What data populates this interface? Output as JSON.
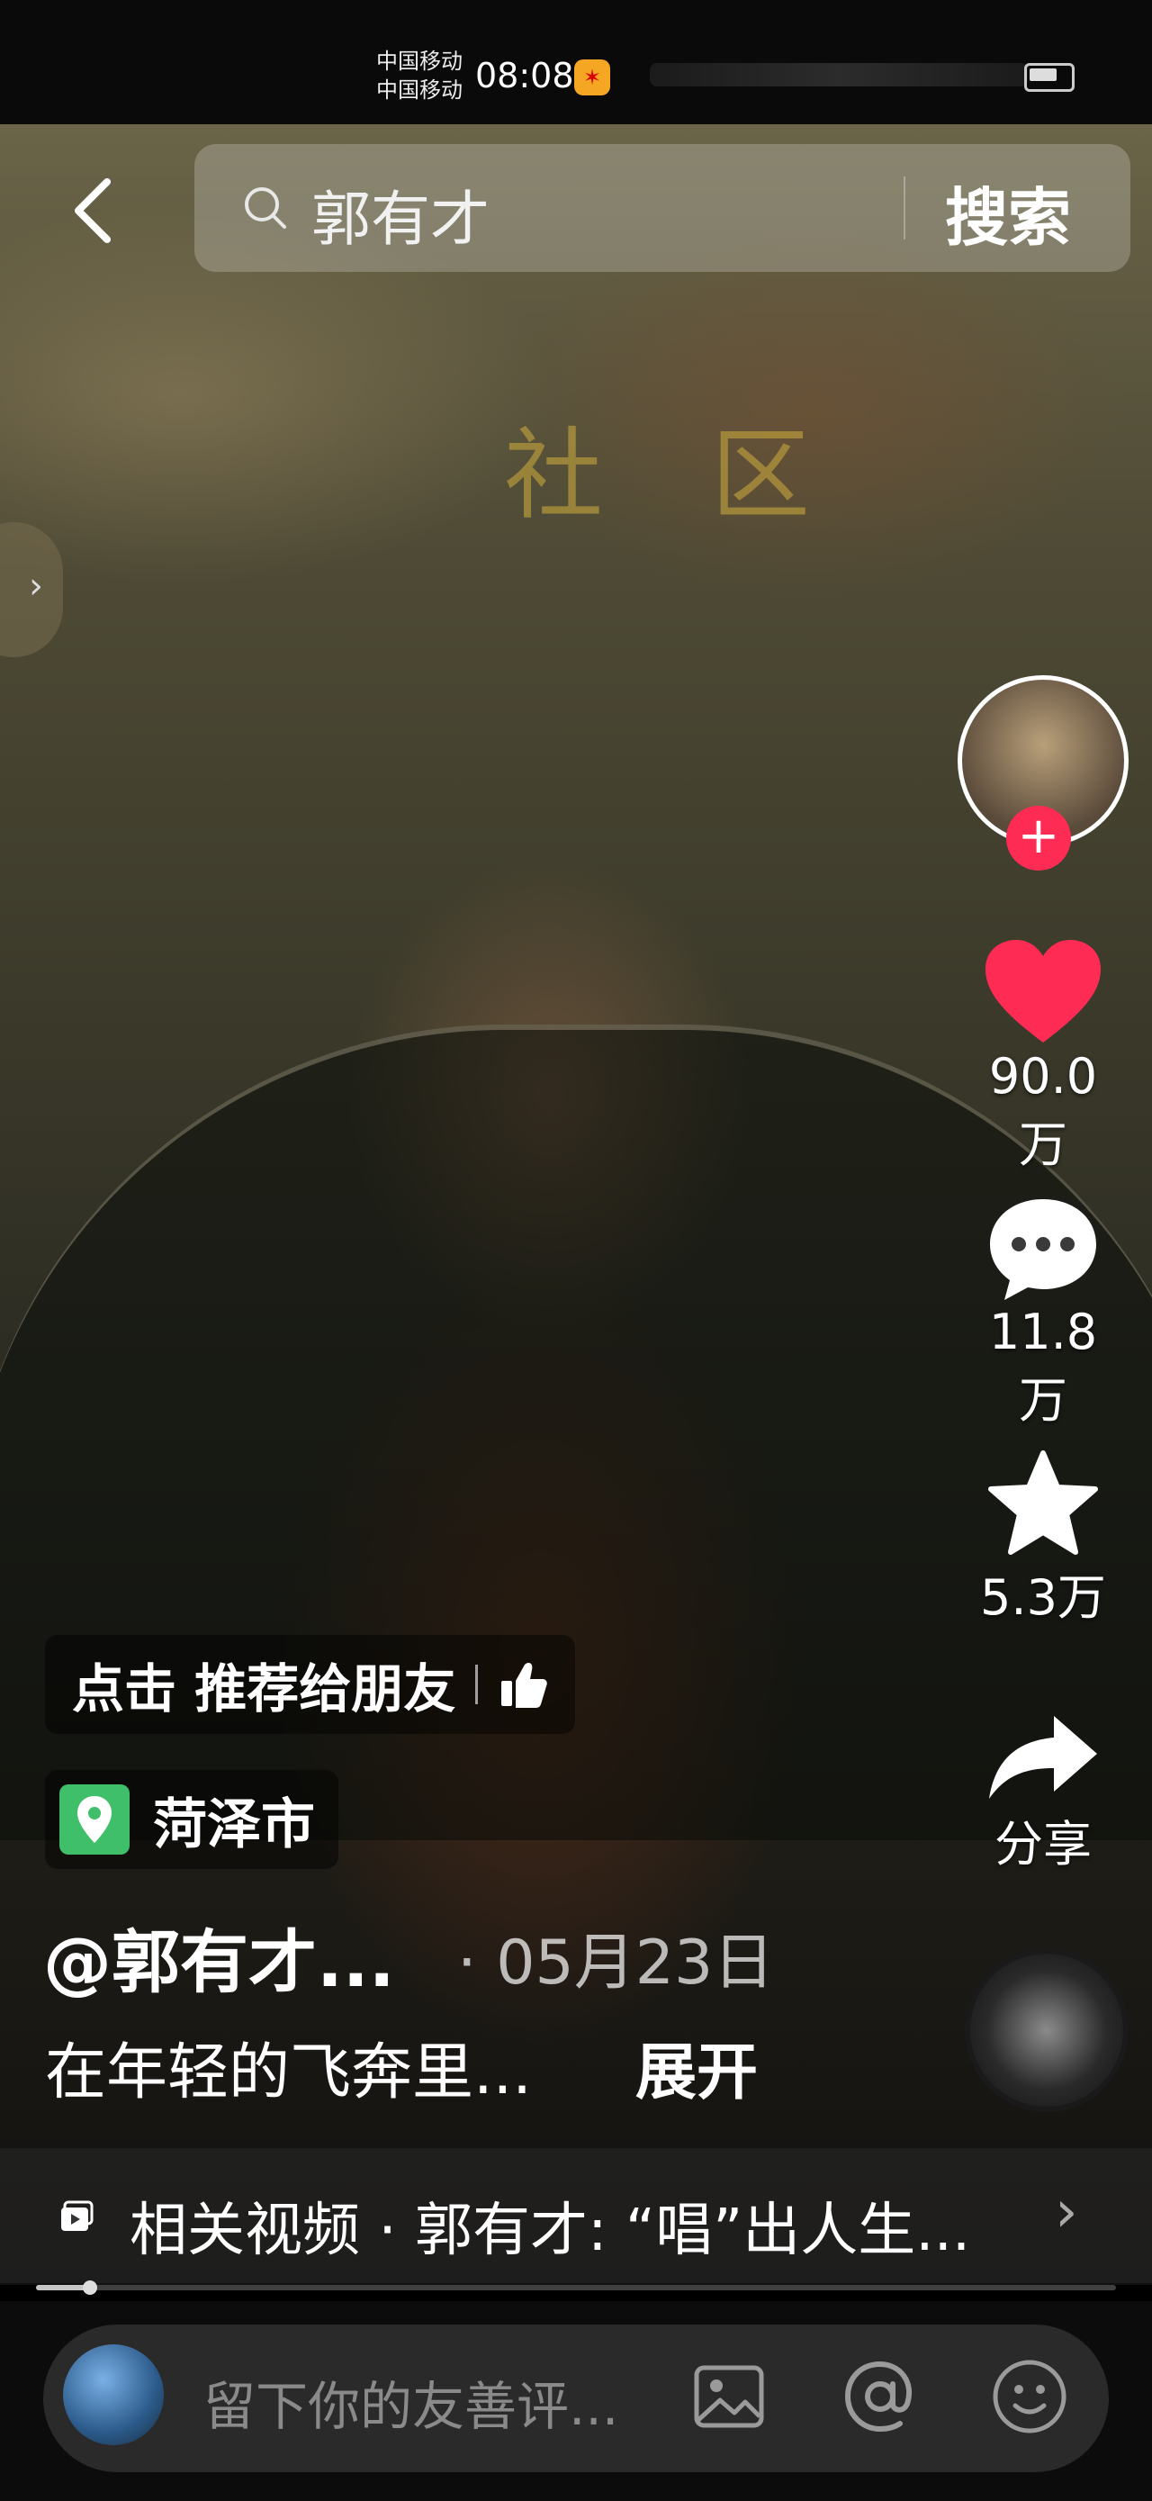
{
  "status_bar": {
    "carrier_1": "中国移动",
    "carrier_2": "中国移动",
    "time": "08:08",
    "weibo_icon": "weibo-icon"
  },
  "search": {
    "query": "郭有才",
    "button_label": "搜索"
  },
  "sidebar": {
    "likes": "90.0万",
    "comments": "11.8万",
    "favorites": "5.3万",
    "share_label": "分享",
    "accent_color": "#fe2c55"
  },
  "recommend": {
    "label": "点击 推荐给朋友"
  },
  "location": {
    "name": "菏泽市"
  },
  "post": {
    "username": "@郭有才...",
    "date": "· 05月23日",
    "caption": "在年轻的飞奔里...",
    "expand_label": "展开"
  },
  "related": {
    "text": "相关视频 · 郭有才: “唱”出人生..."
  },
  "progress": {
    "fraction": 0.05
  },
  "comment": {
    "placeholder": "留下你的友善评..."
  }
}
